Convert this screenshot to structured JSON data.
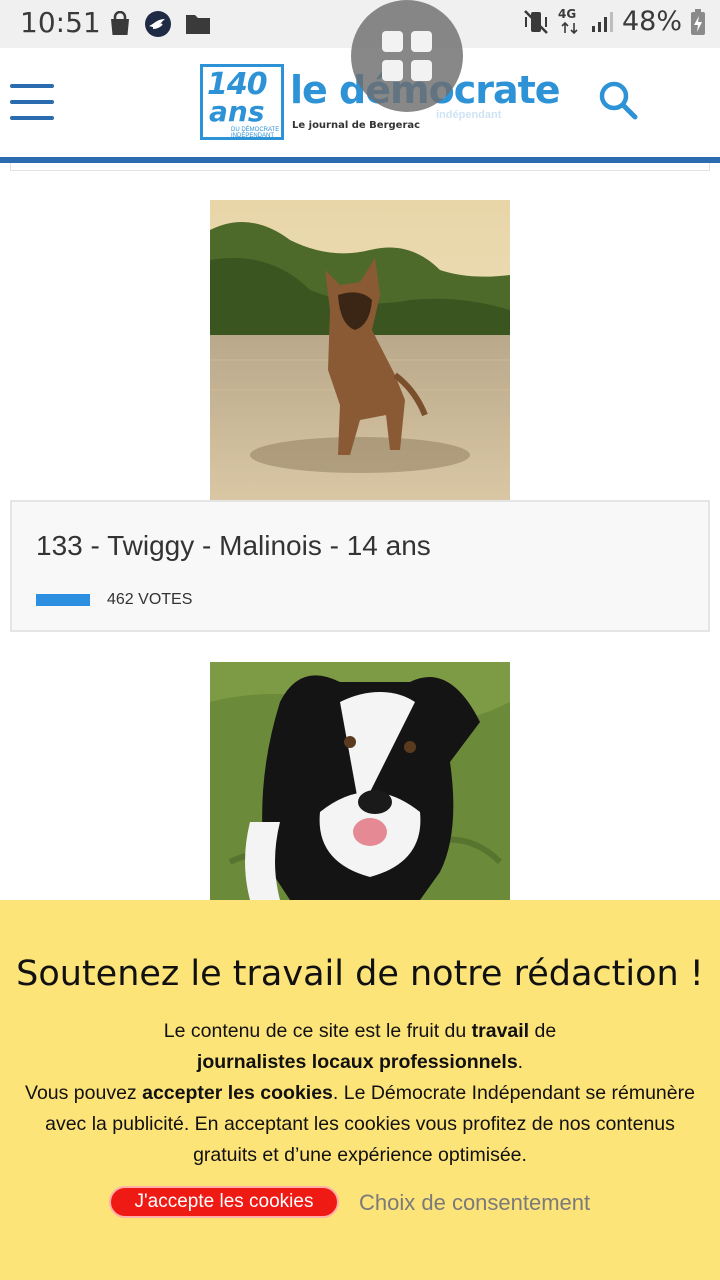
{
  "status_bar": {
    "time": "10:51",
    "network": "4G",
    "battery": "48%",
    "left_icons": [
      "shopping-bag-icon",
      "bird-app-icon",
      "folder-icon"
    ],
    "right_icons": [
      "vibrate-mute-icon",
      "network-4g-icon",
      "signal-icon",
      "battery-charging-icon"
    ]
  },
  "header": {
    "logo": {
      "badge_number": "140",
      "badge_word": "ans",
      "badge_sub": "DU DÉMOCRATE INDÉPENDANT",
      "name": "le démocrate",
      "subtitle": "indépendant",
      "tagline": "Le journal de Bergerac"
    },
    "accent_color": "#2b6cb0"
  },
  "entries": [
    {
      "title": "133 - Twiggy - Malinois - 14 ans",
      "votes": "462 VOTES"
    }
  ],
  "cookie_banner": {
    "title": "Soutenez le travail de notre rédaction !",
    "line1_a": "Le contenu de ce site est le fruit du ",
    "line1_b": "travail",
    "line1_c": " de",
    "line2_a": "journalistes locaux professionnels",
    "line2_b": ".",
    "line3_a": "Vous pouvez ",
    "line3_b": "accepter les cookies",
    "line3_c": ". Le Démocrate Indépendant se rémunère avec la publicité. En acceptant les cookies vous profitez de nos contenus gratuits et d’une expérience optimisée.",
    "accept_label": "J'accepte les cookies",
    "choice_label": "Choix de consentement",
    "background": "#fde479",
    "accept_color": "#ef1a14"
  }
}
